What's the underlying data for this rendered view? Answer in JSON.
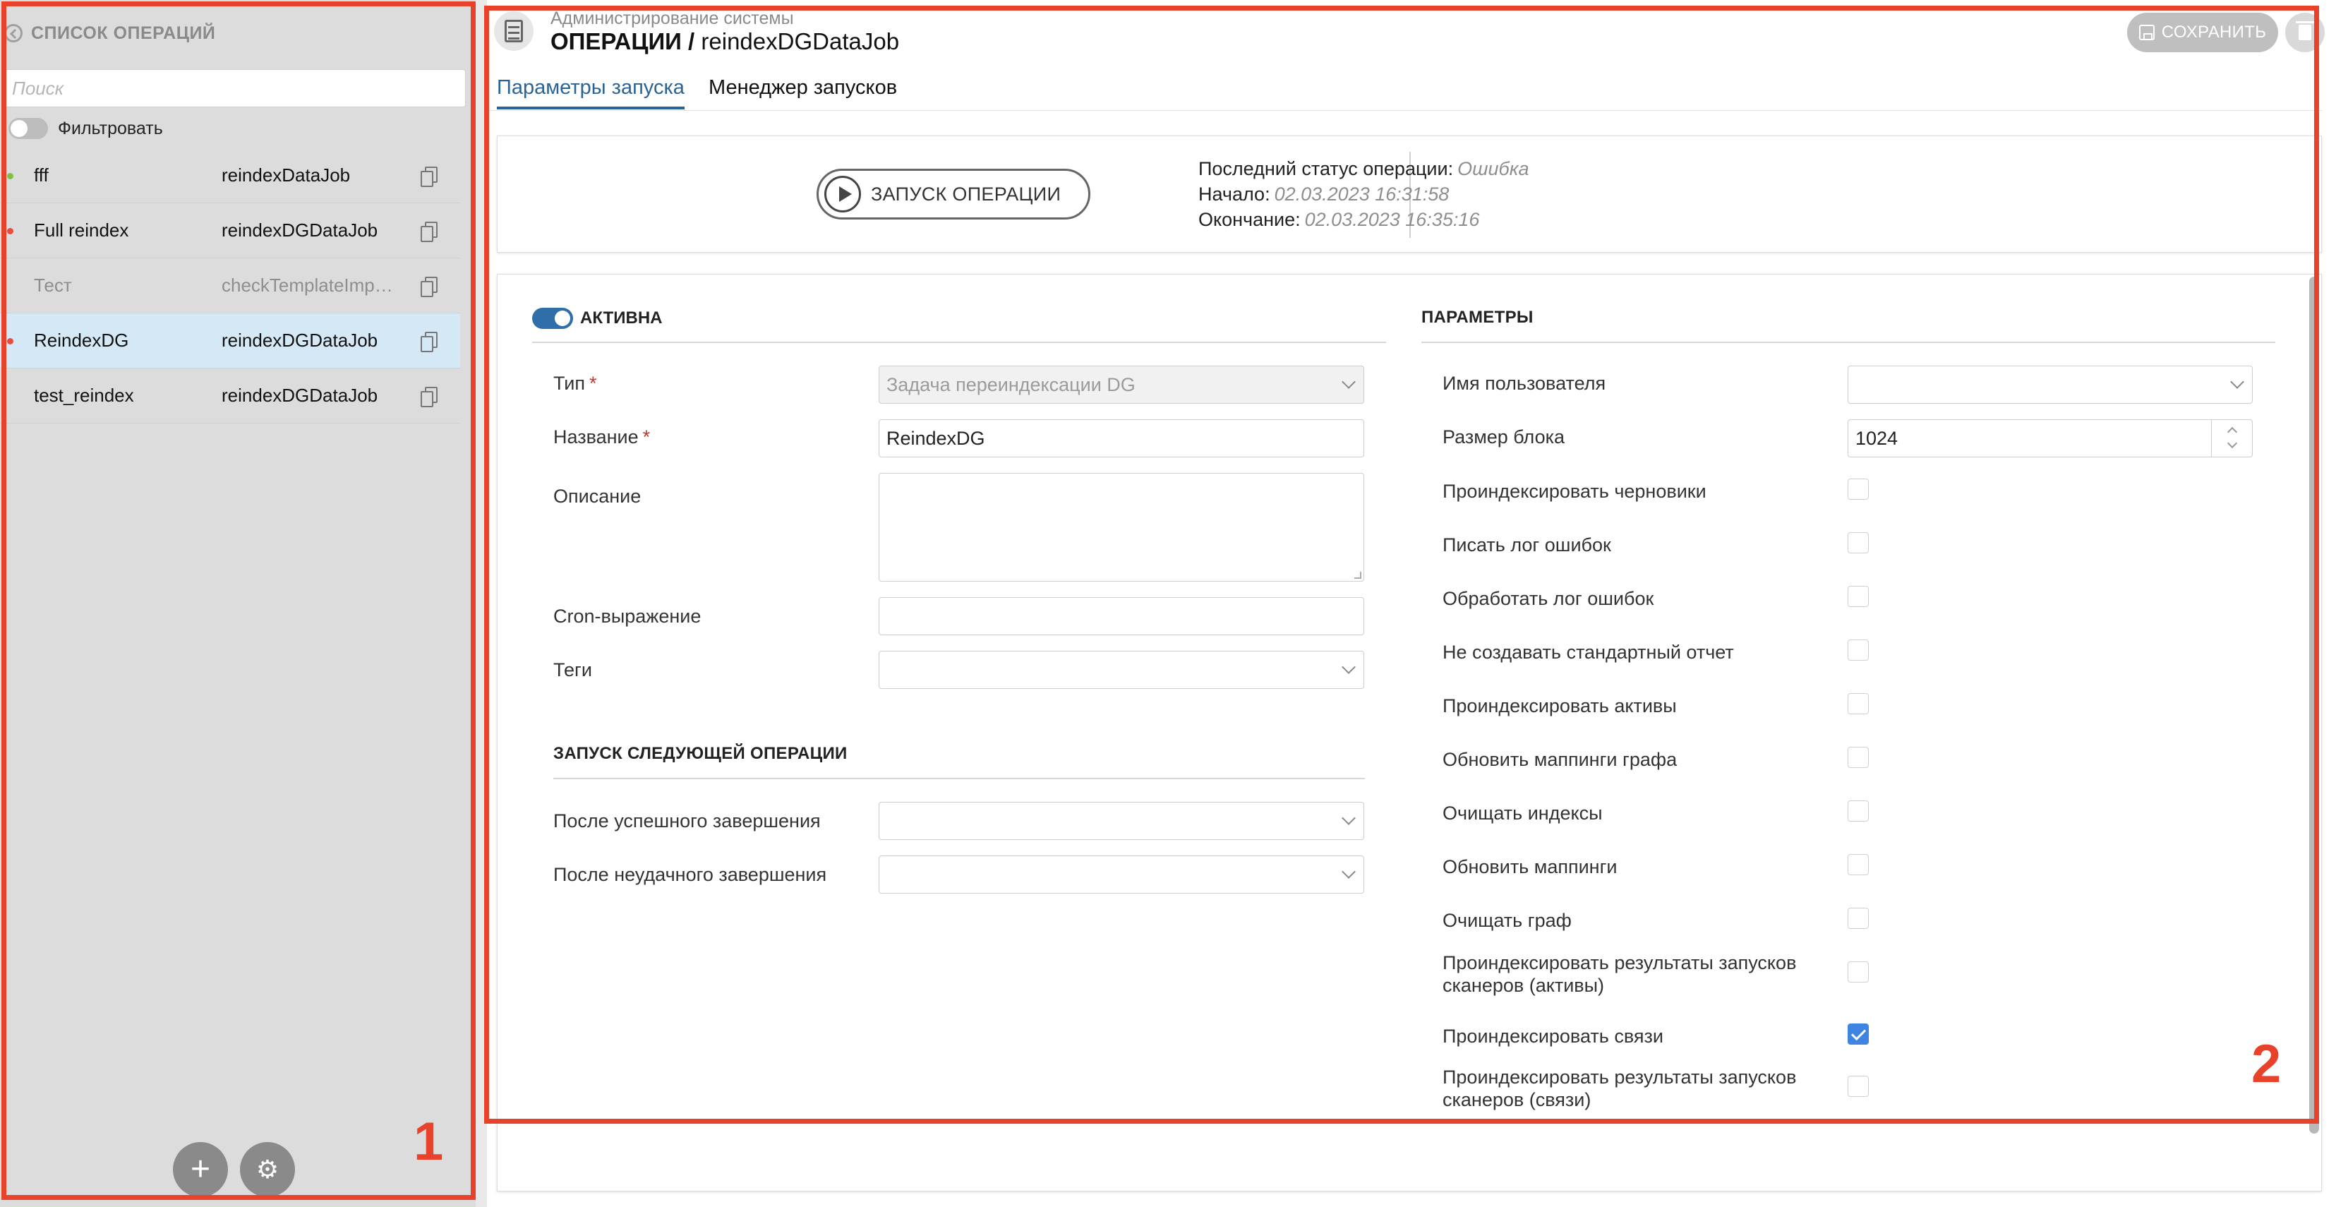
{
  "sidebar": {
    "header": "СПИСОК ОПЕРАЦИЙ",
    "search_placeholder": "Поиск",
    "filter_label": "Фильтровать",
    "items": [
      {
        "name": "fff",
        "job": "reindexDataJob",
        "dot": "#7dc242"
      },
      {
        "name": "Full reindex",
        "job": "reindexDGDataJob",
        "dot": "#e84c3d"
      },
      {
        "name": "Тест",
        "job": "checkTemplateImportJob",
        "dot": ""
      },
      {
        "name": "ReindexDG",
        "job": "reindexDGDataJob",
        "dot": "#e84c3d"
      },
      {
        "name": "test_reindex",
        "job": "reindexDGDataJob",
        "dot": ""
      }
    ],
    "add_glyph": "+",
    "settings_glyph": "⚙"
  },
  "header": {
    "breadcrumb": "Администрирование системы",
    "title_prefix": "ОПЕРАЦИИ /",
    "title_job": "reindexDGDataJob",
    "save_label": "СОХРАНИТЬ"
  },
  "tabs": [
    "Параметры запуска",
    "Менеджер запусков"
  ],
  "run": {
    "button_label": "ЗАПУСК ОПЕРАЦИИ",
    "status_label": "Последний статус операции:",
    "status_value": "Ошибка",
    "start_label": "Начало:",
    "start_value": "02.03.2023 16:31:58",
    "end_label": "Окончание:",
    "end_value": "02.03.2023 16:35:16"
  },
  "form": {
    "active_label": "АКТИВНА",
    "type_label": "Тип",
    "type_value": "Задача переиндексации DG",
    "name_label": "Название",
    "name_value": "ReindexDG",
    "description_label": "Описание",
    "cron_label": "Cron-выражение",
    "tags_label": "Теги",
    "next_section": "ЗАПУСК СЛЕДУЮЩЕЙ ОПЕРАЦИИ",
    "after_success_label": "После успешного завершения",
    "after_fail_label": "После неудачного завершения",
    "required_mark": "*"
  },
  "params": {
    "section": "ПАРАМЕТРЫ",
    "user_label": "Имя пользователя",
    "block_label": "Размер блока",
    "block_value": "1024",
    "checks": [
      {
        "label": "Проиндексировать черновики",
        "checked": false
      },
      {
        "label": "Писать лог ошибок",
        "checked": false
      },
      {
        "label": "Обработать лог ошибок",
        "checked": false
      },
      {
        "label": "Не создавать стандартный отчет",
        "checked": false
      },
      {
        "label": "Проиндексировать активы",
        "checked": false
      },
      {
        "label": "Обновить маппинги графа",
        "checked": false
      },
      {
        "label": "Очищать индексы",
        "checked": false
      },
      {
        "label": "Обновить маппинги",
        "checked": false
      },
      {
        "label": "Очищать граф",
        "checked": false
      },
      {
        "label": "Проиндексировать результаты запусков сканеров (активы)",
        "checked": false
      },
      {
        "label": "Проиндексировать связи",
        "checked": true
      },
      {
        "label": "Проиндексировать результаты запусков сканеров (связи)",
        "checked": false
      }
    ]
  },
  "annotations": [
    "1",
    "2"
  ],
  "colors": {
    "accent": "#2a6496",
    "annotation": "#e8432a",
    "selected_row": "#d4e8f5"
  }
}
